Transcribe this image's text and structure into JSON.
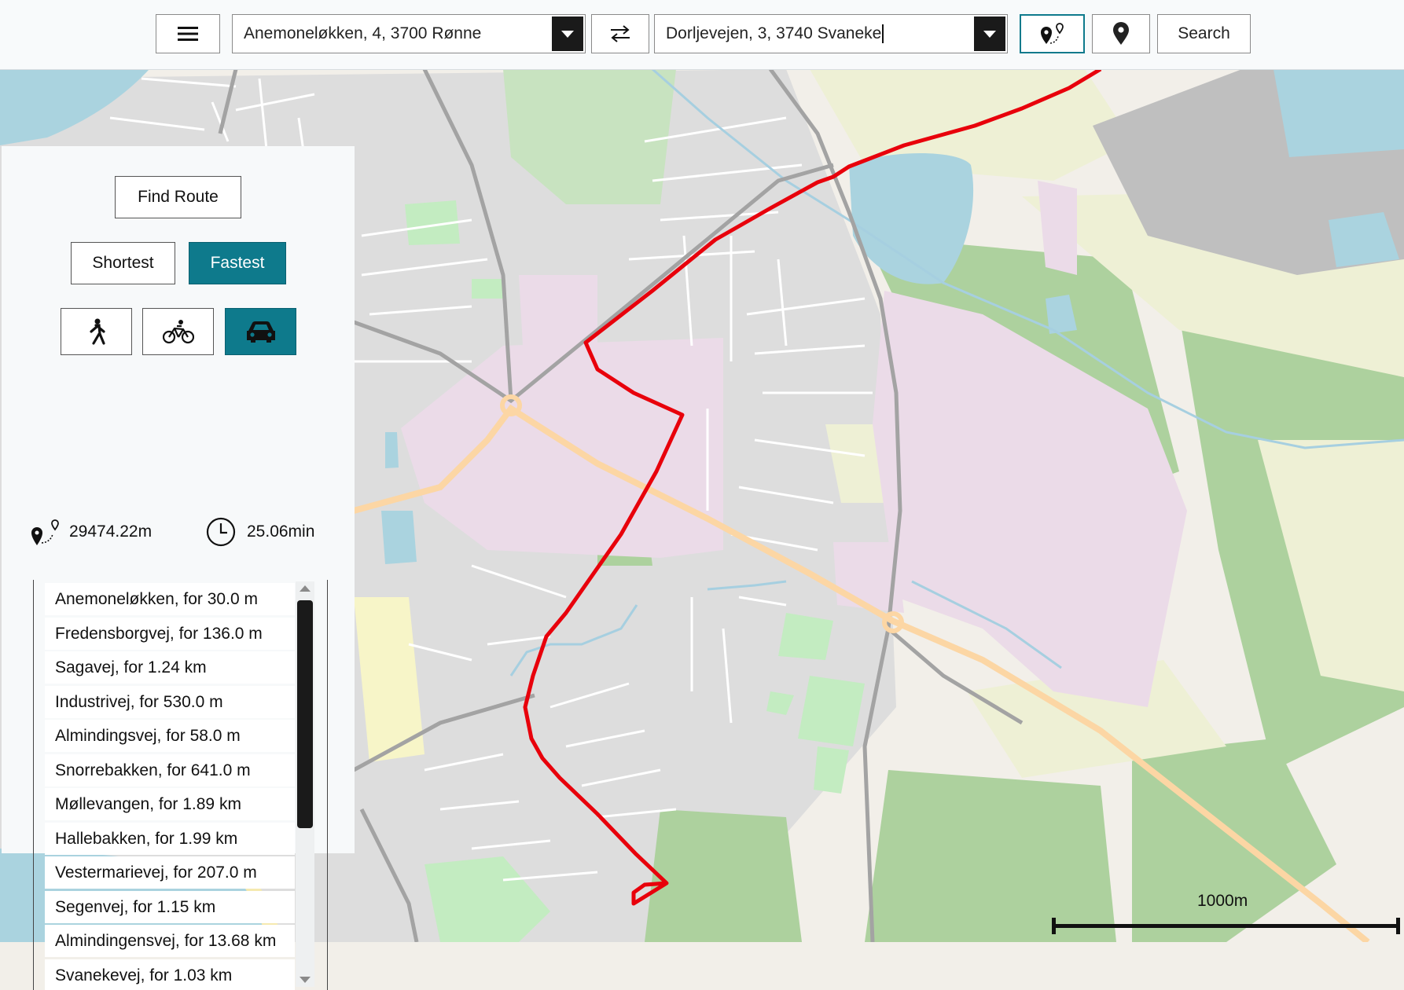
{
  "toolbar": {
    "menu_icon": "hamburger-icon",
    "from_value": "Anemoneløkken, 4, 3700 Rønne",
    "to_value": "Dorljevejen, 3, 3740 Svaneke",
    "swap_icon": "swap-arrows-icon",
    "route_mode_icon": "route-pin-icon",
    "location_icon": "map-pin-icon",
    "search_label": "Search",
    "accent_color": "#0e7a8c"
  },
  "panel": {
    "find_route_label": "Find Route",
    "shortest_label": "Shortest",
    "fastest_label": "Fastest",
    "active_criterion": "Fastest",
    "modes": [
      "walk",
      "bike",
      "car"
    ],
    "active_mode": "car",
    "distance": "29474.22m",
    "duration": "25.06min",
    "directions": [
      "Anemoneløkken, for 30.0 m",
      "Fredensborgvej, for 136.0 m",
      "Sagavej, for 1.24 km",
      "Industrivej, for 530.0 m",
      "Almindingsvej, for 58.0 m",
      "Snorrebakken, for 641.0 m",
      "Møllevangen, for 1.89 km",
      "Hallebakken, for 1.99 km",
      "Vestermarievej, for 207.0 m",
      "Segenvej, for 1.15 km",
      "Almindingensvej, for 13.68 km",
      "Svanekevej, for 1.03 km"
    ]
  },
  "map": {
    "scale_label": "1000m",
    "route_color": "#e8000b"
  }
}
